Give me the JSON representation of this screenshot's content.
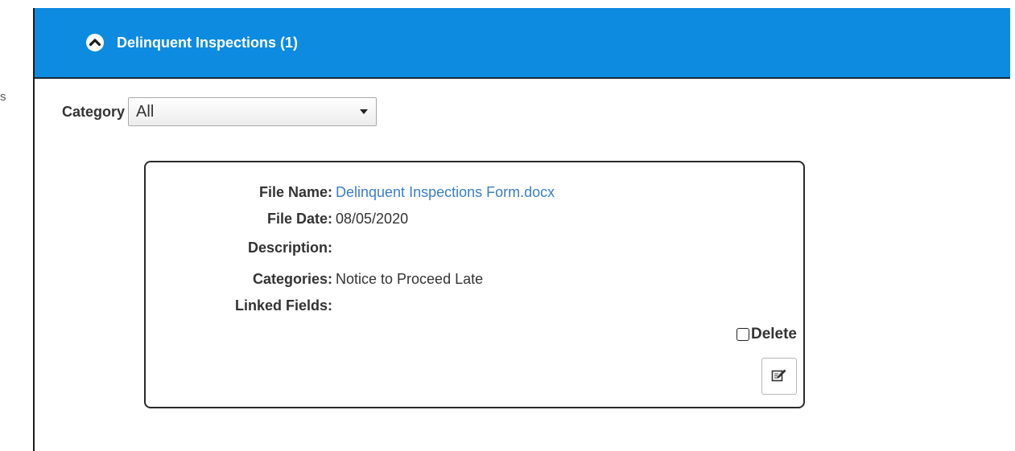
{
  "sidebar": {
    "edge_text": "s"
  },
  "panel": {
    "title": "Delinquent Inspections (1)",
    "header_color": "#0d8be0",
    "collapse_icon": "chevron-up-circle-icon"
  },
  "filter": {
    "label": "Category",
    "selected": "All"
  },
  "file": {
    "fields": [
      {
        "label": "File Name:",
        "value": "Delinquent Inspections Form.docx",
        "is_link": true
      },
      {
        "label": "File Date:",
        "value": "08/05/2020"
      },
      {
        "label": "Description:",
        "value": ""
      },
      {
        "label": "Categories:",
        "value": "Notice to Proceed Late"
      },
      {
        "label": "Linked Fields:",
        "value": ""
      }
    ],
    "delete_label": "Delete",
    "delete_checked": false,
    "edit_icon": "edit-note-icon"
  }
}
